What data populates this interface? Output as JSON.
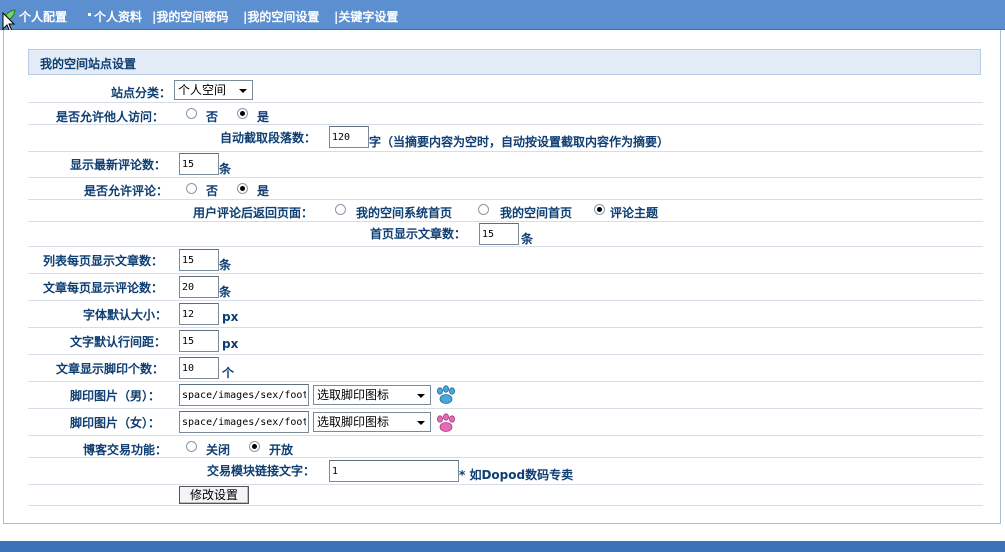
{
  "nav": {
    "personal_config": "个人配置",
    "personal_info": "个人资料",
    "space_password": "|我的空间密码",
    "space_settings": "|我的空间设置",
    "keyword_settings": "|关键字设置"
  },
  "section_title": "我的空间站点设置",
  "form": {
    "site_category": {
      "label": "站点分类：",
      "value": "个人空间"
    },
    "allow_visit": {
      "label": "是否允许他人访问：",
      "no": "否",
      "yes": "是",
      "selected": "yes"
    },
    "auto_excerpt": {
      "label": "自动截取段落数：",
      "value": "120",
      "note": "字（当摘要内容为空时，自动按设置截取内容作为摘要）"
    },
    "latest_comments": {
      "label": "显示最新评论数：",
      "value": "15",
      "unit": "条"
    },
    "allow_comment": {
      "label": "是否允许评论：",
      "no": "否",
      "yes": "是",
      "selected": "yes"
    },
    "comment_return": {
      "label": "用户评论后返回页面：",
      "opt1": "我的空间系统首页",
      "opt2": "我的空间首页",
      "opt3": "评论主题",
      "selected": "opt3"
    },
    "home_articles": {
      "label": "首页显示文章数：",
      "value": "15",
      "unit": "条"
    },
    "list_articles": {
      "label": "列表每页显示文章数：",
      "value": "15",
      "unit": "条"
    },
    "article_comments": {
      "label": "文章每页显示评论数：",
      "value": "20",
      "unit": "条"
    },
    "font_size": {
      "label": "字体默认大小：",
      "value": "12",
      "unit": "px"
    },
    "line_height": {
      "label": "文字默认行间距：",
      "value": "15",
      "unit": "px"
    },
    "footprints": {
      "label": "文章显示脚印个数：",
      "value": "10",
      "unit": "个"
    },
    "footprint_male": {
      "label": "脚印图片（男）：",
      "value": "space/images/sex/foote",
      "select": "选取脚印图标",
      "paw_color": "#4aa6d6"
    },
    "footprint_female": {
      "label": "脚印图片（女）：",
      "value": "space/images/sex/foote",
      "select": "选取脚印图标",
      "paw_color": "#e86ab6"
    },
    "blog_trade": {
      "label": "博客交易功能：",
      "off": "关闭",
      "on": "开放",
      "selected": "on"
    },
    "trade_link_text": {
      "label": "交易模块链接文字：",
      "value": "1",
      "note": "* 如Dopod数码专卖"
    },
    "submit_label": "修改设置"
  },
  "colors": {
    "topbar": "#5b8fd0",
    "text": "#0e3e72",
    "section_bg": "#e3ecf6",
    "bottombar": "#3c72b8"
  }
}
